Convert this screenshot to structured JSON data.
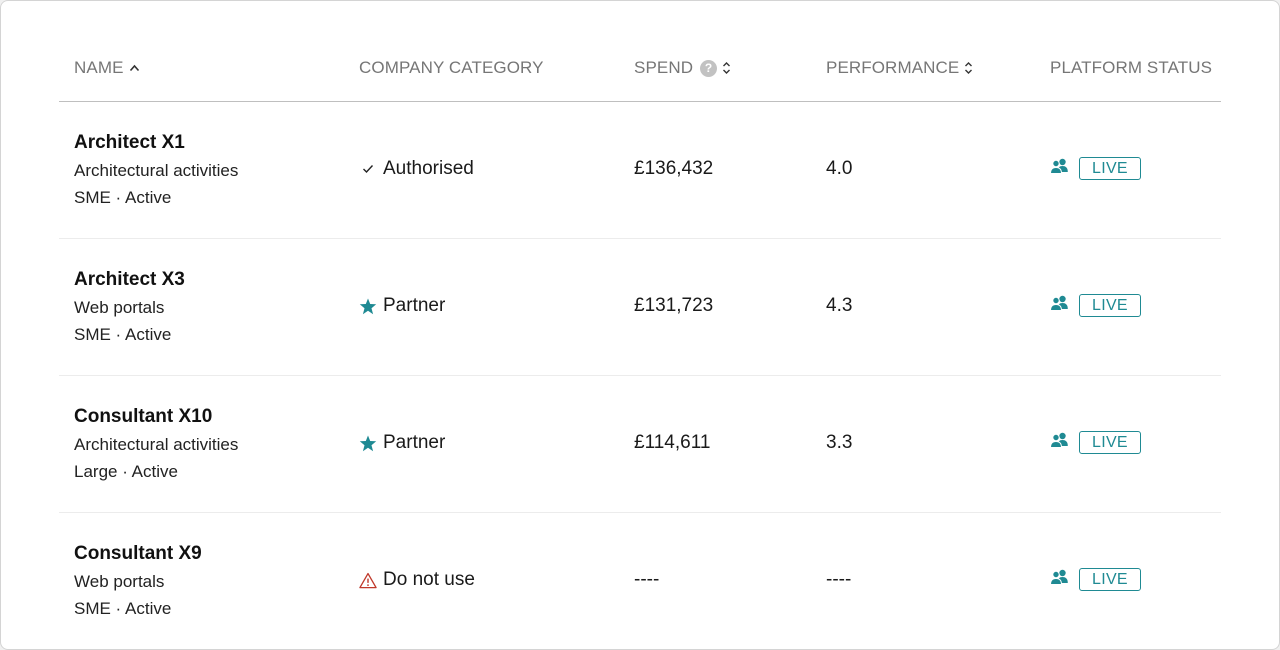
{
  "columns": {
    "name": "NAME",
    "category": "COMPANY CATEGORY",
    "spend": "SPEND",
    "spend_help": "?",
    "performance": "PERFORMANCE",
    "status": "PLATFORM STATUS"
  },
  "colors": {
    "accent": "#1f8a93",
    "warning": "#c0392b",
    "header_text": "#767676"
  },
  "rows": [
    {
      "name": "Architect X1",
      "activity": "Architectural activities",
      "meta": "SME · Active",
      "category": "Authorised",
      "category_icon": "check-icon",
      "spend": "£136,432",
      "performance": "4.0",
      "status": "LIVE"
    },
    {
      "name": "Architect X3",
      "activity": "Web portals",
      "meta": "SME · Active",
      "category": "Partner",
      "category_icon": "star-icon",
      "spend": "£131,723",
      "performance": "4.3",
      "status": "LIVE"
    },
    {
      "name": "Consultant X10",
      "activity": "Architectural activities",
      "meta": "Large · Active",
      "category": "Partner",
      "category_icon": "star-icon",
      "spend": "£114,611",
      "performance": "3.3",
      "status": "LIVE"
    },
    {
      "name": "Consultant X9",
      "activity": "Web portals",
      "meta": "SME · Active",
      "category": "Do not use",
      "category_icon": "warning-icon",
      "spend": "----",
      "performance": "----",
      "status": "LIVE"
    }
  ]
}
